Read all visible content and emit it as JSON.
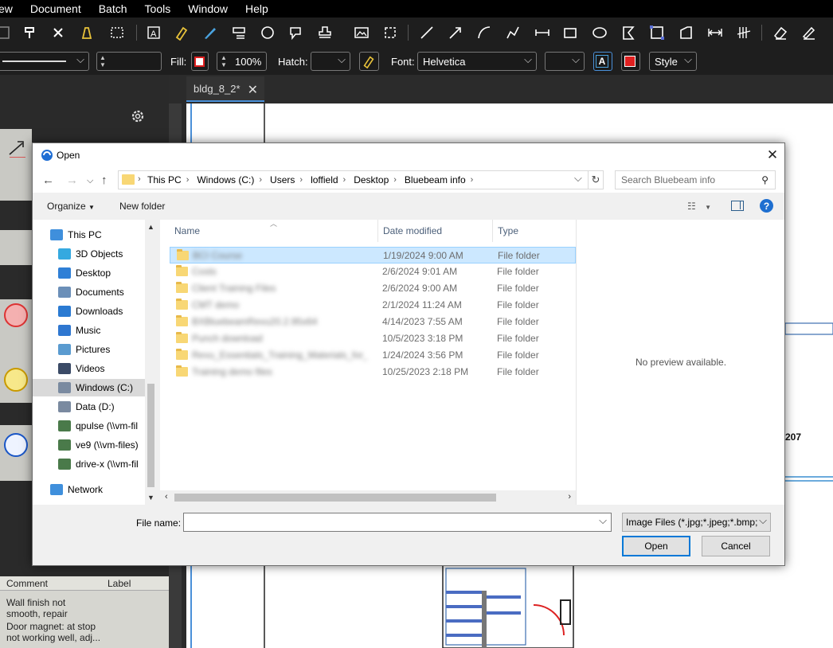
{
  "app": {
    "menu": [
      "ew",
      "Document",
      "Batch",
      "Tools",
      "Window",
      "Help"
    ],
    "toolbar2": {
      "fill_label": "Fill:",
      "opacity": "100%",
      "hatch_label": "Hatch:",
      "font_label": "Font:",
      "font_value": "Helvetica",
      "style_label": "Style"
    },
    "doc_tab": "bldg_8_2*",
    "comments_panel": {
      "col_comment": "Comment",
      "col_label": "Label",
      "rows": [
        "Wall finish not",
        "smooth, repair",
        "Door magnet: at stop",
        "not working well, adj..."
      ]
    },
    "drawing_label": "207"
  },
  "dialog": {
    "title": "Open",
    "breadcrumbs": [
      "This PC",
      "Windows (C:)",
      "Users",
      "loffield",
      "Desktop",
      "Bluebeam info"
    ],
    "search_placeholder": "Search Bluebeam info",
    "organize_label": "Organize",
    "new_folder_label": "New folder",
    "nav_items": [
      {
        "label": "This PC",
        "icon": "computer-icon"
      },
      {
        "label": "3D Objects",
        "icon": "3d-objects-icon"
      },
      {
        "label": "Desktop",
        "icon": "desktop-icon"
      },
      {
        "label": "Documents",
        "icon": "documents-icon"
      },
      {
        "label": "Downloads",
        "icon": "downloads-icon"
      },
      {
        "label": "Music",
        "icon": "music-icon"
      },
      {
        "label": "Pictures",
        "icon": "pictures-icon"
      },
      {
        "label": "Videos",
        "icon": "videos-icon"
      },
      {
        "label": "Windows (C:)",
        "icon": "drive-icon"
      },
      {
        "label": "Data (D:)",
        "icon": "drive-icon"
      },
      {
        "label": "qpulse (\\\\vm-fil",
        "icon": "network-drive-icon"
      },
      {
        "label": "ve9 (\\\\vm-files)",
        "icon": "network-drive-icon"
      },
      {
        "label": "drive-x (\\\\vm-fil",
        "icon": "network-drive-icon"
      },
      {
        "label": "Network",
        "icon": "network-icon"
      }
    ],
    "columns": {
      "name": "Name",
      "date": "Date modified",
      "type": "Type"
    },
    "files": [
      {
        "name": "BCI Course",
        "date": "1/19/2024 9:00 AM",
        "type": "File folder"
      },
      {
        "name": "Costs",
        "date": "2/6/2024 9:01 AM",
        "type": "File folder"
      },
      {
        "name": "Client Training Files",
        "date": "2/6/2024 9:00 AM",
        "type": "File folder"
      },
      {
        "name": "CMT demo",
        "date": "2/1/2024 11:24 AM",
        "type": "File folder"
      },
      {
        "name": "BXBluebeamRevu20.2.95x64",
        "date": "4/14/2023 7:55 AM",
        "type": "File folder"
      },
      {
        "name": "Punch download",
        "date": "10/5/2023 3:18 PM",
        "type": "File folder"
      },
      {
        "name": "Revu_Essentials_Training_Materials_for_E...",
        "date": "1/24/2024 3:56 PM",
        "type": "File folder"
      },
      {
        "name": "Training demo files",
        "date": "10/25/2023 2:18 PM",
        "type": "File folder"
      }
    ],
    "preview_text": "No preview available.",
    "file_name_label": "File name:",
    "file_name_value": "",
    "filter_value": "Image Files (*.jpg;*.jpeg;*.bmp;",
    "open_label": "Open",
    "cancel_label": "Cancel"
  }
}
